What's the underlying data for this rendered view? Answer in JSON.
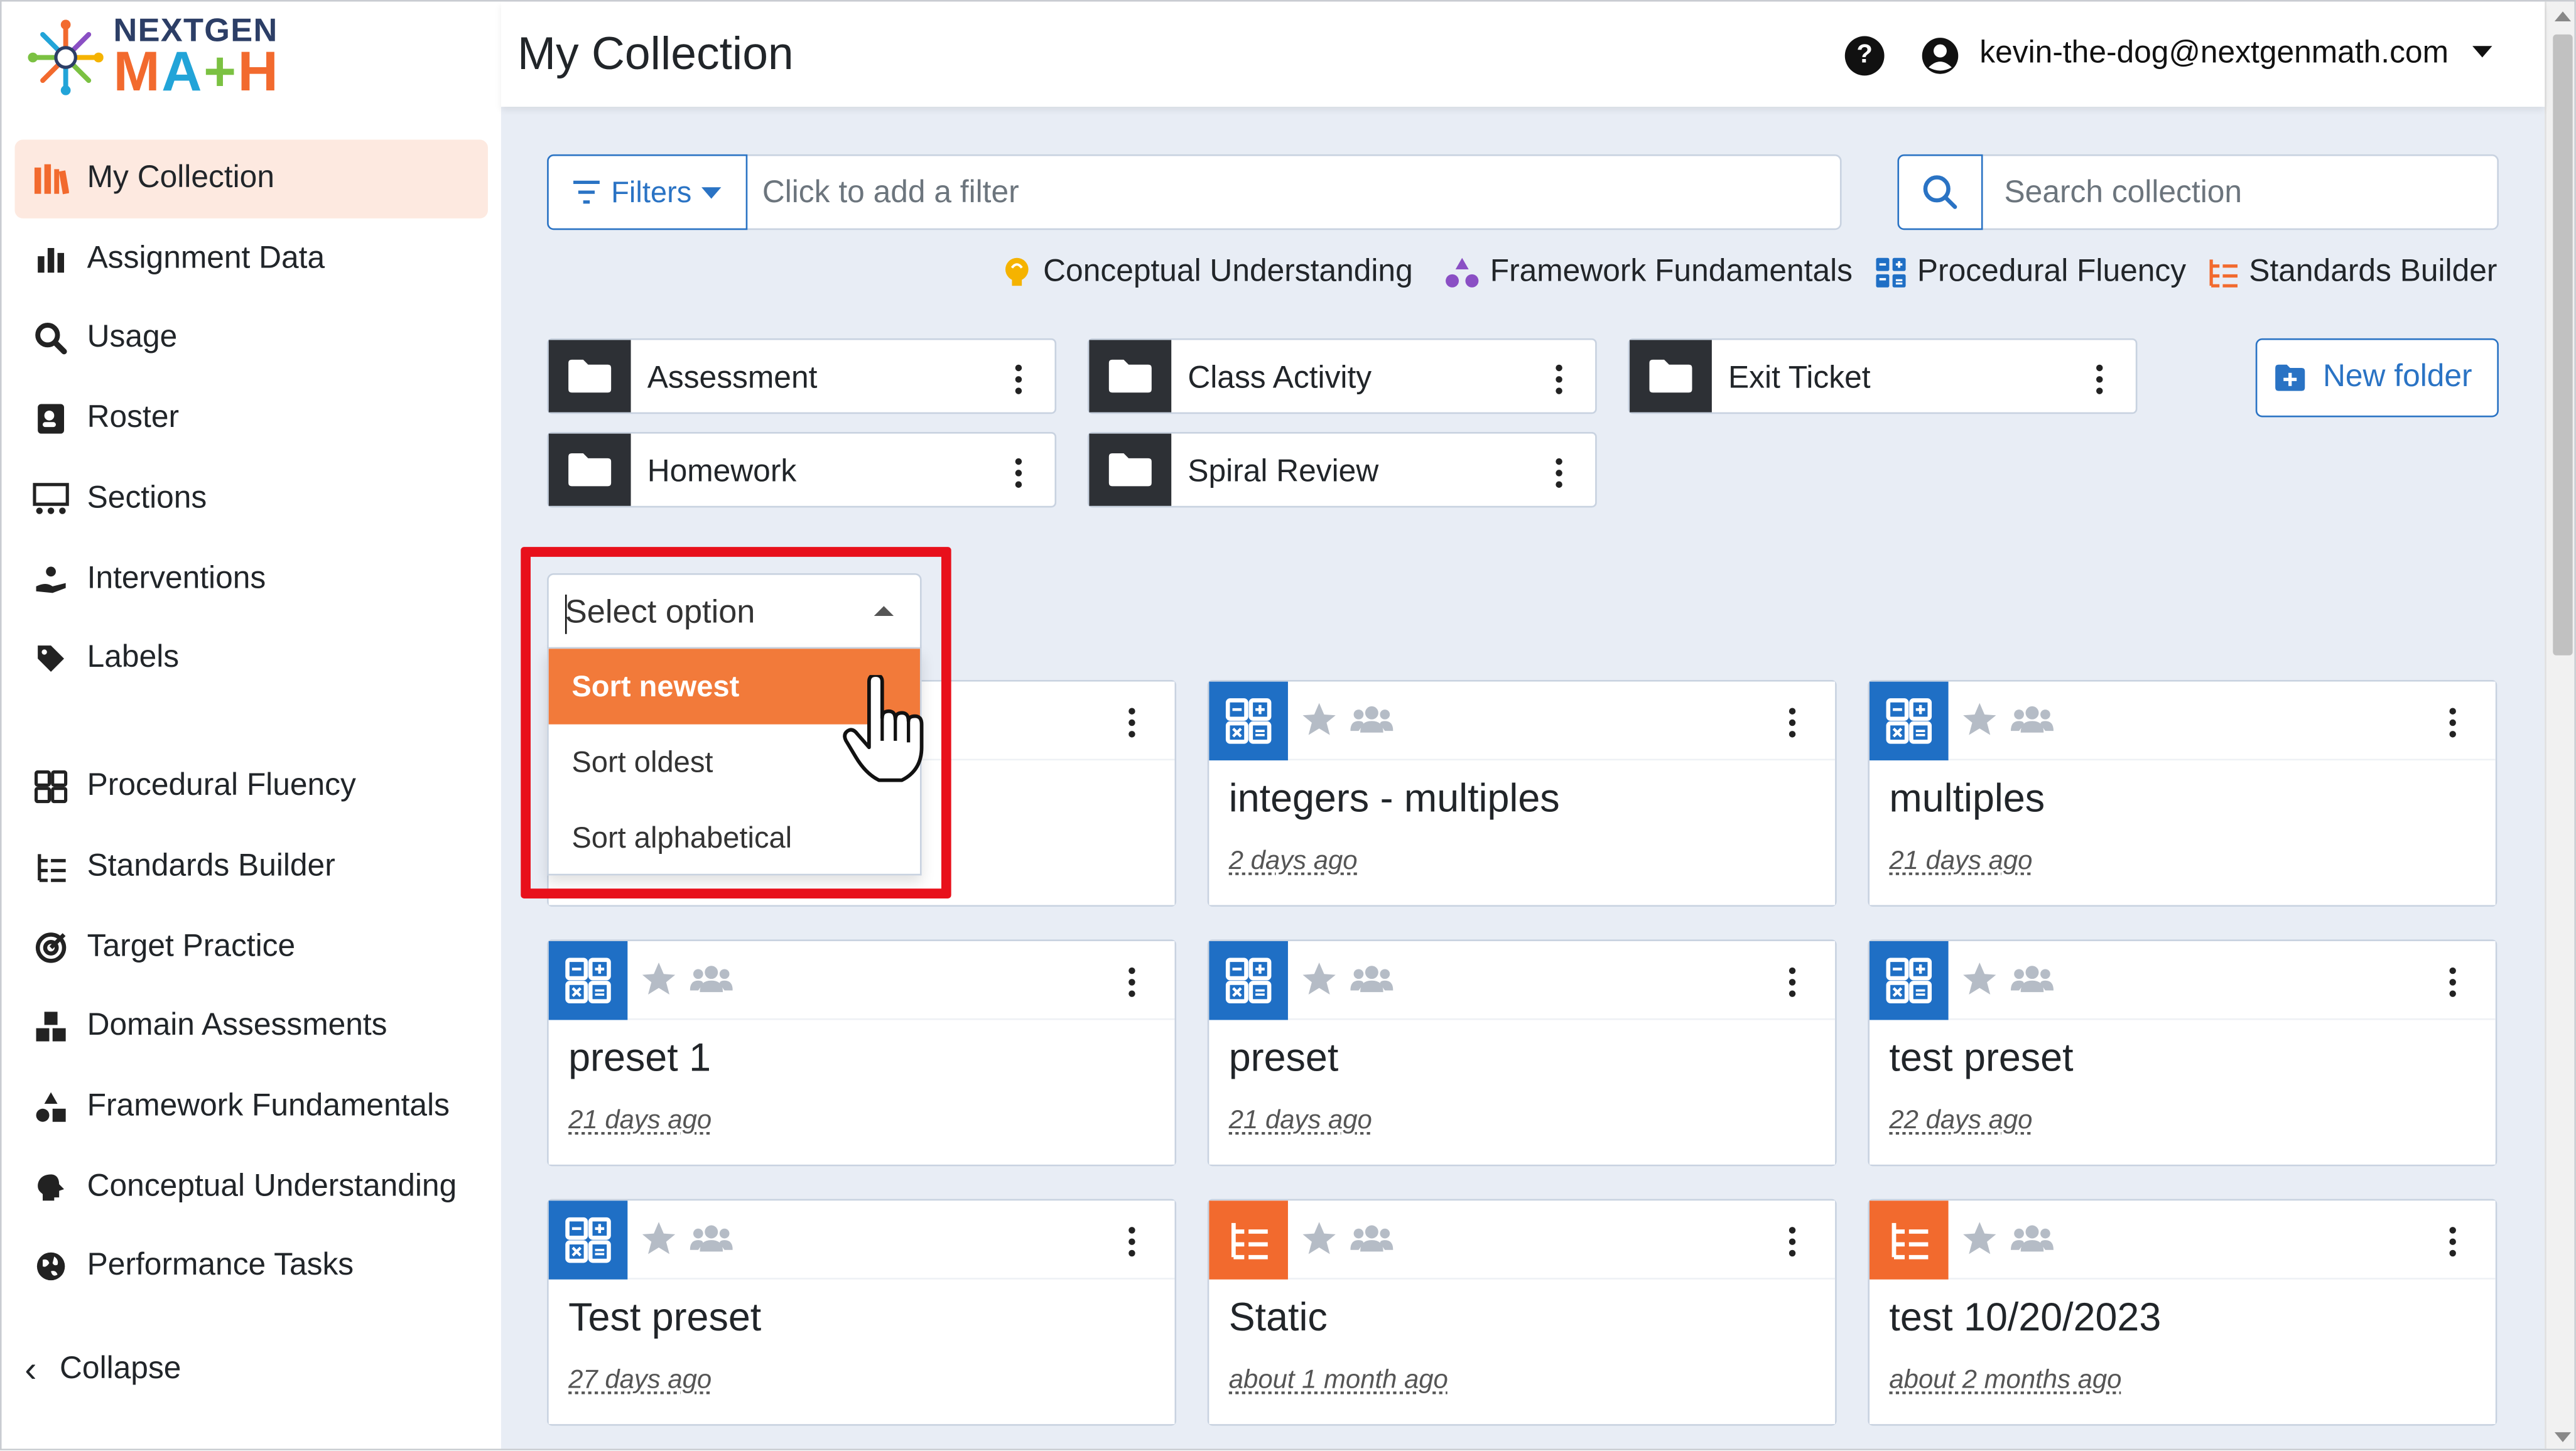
{
  "brand": {
    "line1": "NEXTGEN",
    "line2_parts": [
      "M",
      "A",
      "+",
      "H"
    ]
  },
  "sidebar": {
    "items": [
      {
        "label": "My Collection",
        "icon": "collection-icon",
        "active": true
      },
      {
        "label": "Assignment Data",
        "icon": "bar-chart-icon"
      },
      {
        "label": "Usage",
        "icon": "usage-search-icon"
      },
      {
        "label": "Roster",
        "icon": "roster-icon"
      },
      {
        "label": "Sections",
        "icon": "sections-icon"
      },
      {
        "label": "Interventions",
        "icon": "interventions-icon"
      },
      {
        "label": "Labels",
        "icon": "tag-icon"
      },
      {
        "label": "Procedural Fluency",
        "icon": "calculator-grid-icon"
      },
      {
        "label": "Standards Builder",
        "icon": "standards-list-icon"
      },
      {
        "label": "Target Practice",
        "icon": "target-icon"
      },
      {
        "label": "Domain Assessments",
        "icon": "cubes-icon"
      },
      {
        "label": "Framework Fundamentals",
        "icon": "shapes-icon"
      },
      {
        "label": "Conceptual Understanding",
        "icon": "brain-icon"
      },
      {
        "label": "Performance Tasks",
        "icon": "globe-icon"
      }
    ],
    "collapse_label": "Collapse"
  },
  "header": {
    "title": "My Collection",
    "help_glyph": "?",
    "account_email": "kevin-the-dog@nextgenmath.com"
  },
  "filter": {
    "button_label": "Filters",
    "placeholder": "Click to add a filter"
  },
  "search": {
    "placeholder": "Search collection"
  },
  "legend": [
    {
      "label": "Conceptual Understanding",
      "icon": "lightbulb-icon",
      "color": "#f5b300"
    },
    {
      "label": "Framework Fundamentals",
      "icon": "shapes-icon",
      "color": "#8a4fc4"
    },
    {
      "label": "Procedural Fluency",
      "icon": "calculator-grid-icon",
      "color": "#1f6fc5"
    },
    {
      "label": "Standards Builder",
      "icon": "standards-list-icon",
      "color": "#f26a2e"
    }
  ],
  "folders": [
    {
      "name": "Assessment"
    },
    {
      "name": "Class Activity"
    },
    {
      "name": "Exit Ticket"
    },
    {
      "name": "Homework"
    },
    {
      "name": "Spiral Review"
    }
  ],
  "new_folder_label": "New folder",
  "sort": {
    "placeholder": "Select option",
    "options": [
      {
        "label": "Sort newest",
        "selected": true
      },
      {
        "label": "Sort oldest"
      },
      {
        "label": "Sort alphabetical"
      }
    ]
  },
  "cards": [
    {
      "title": "",
      "date": "",
      "type": "procedural-fluency"
    },
    {
      "title": "integers - multiples",
      "date": "2 days ago",
      "type": "procedural-fluency"
    },
    {
      "title": "multiples",
      "date": "21 days ago",
      "type": "procedural-fluency"
    },
    {
      "title": "preset 1",
      "date": "21 days ago",
      "type": "procedural-fluency"
    },
    {
      "title": "preset",
      "date": "21 days ago",
      "type": "procedural-fluency"
    },
    {
      "title": "test preset",
      "date": "22 days ago",
      "type": "procedural-fluency"
    },
    {
      "title": "Test preset",
      "date": "27 days ago",
      "type": "procedural-fluency"
    },
    {
      "title": "Static",
      "date": "about 1 month ago",
      "type": "standards-builder"
    },
    {
      "title": "test 10/20/2023",
      "date": "about 2 months ago",
      "type": "standards-builder"
    }
  ],
  "colors": {
    "accent_blue": "#2a73c4",
    "procedural_blue": "#1f6fc5",
    "standards_orange": "#f26a2e",
    "selected_option": "#f27a3a",
    "highlight_red": "#e8101b",
    "active_nav_bg": "#fde9e0",
    "main_bg": "#e8edf5"
  }
}
